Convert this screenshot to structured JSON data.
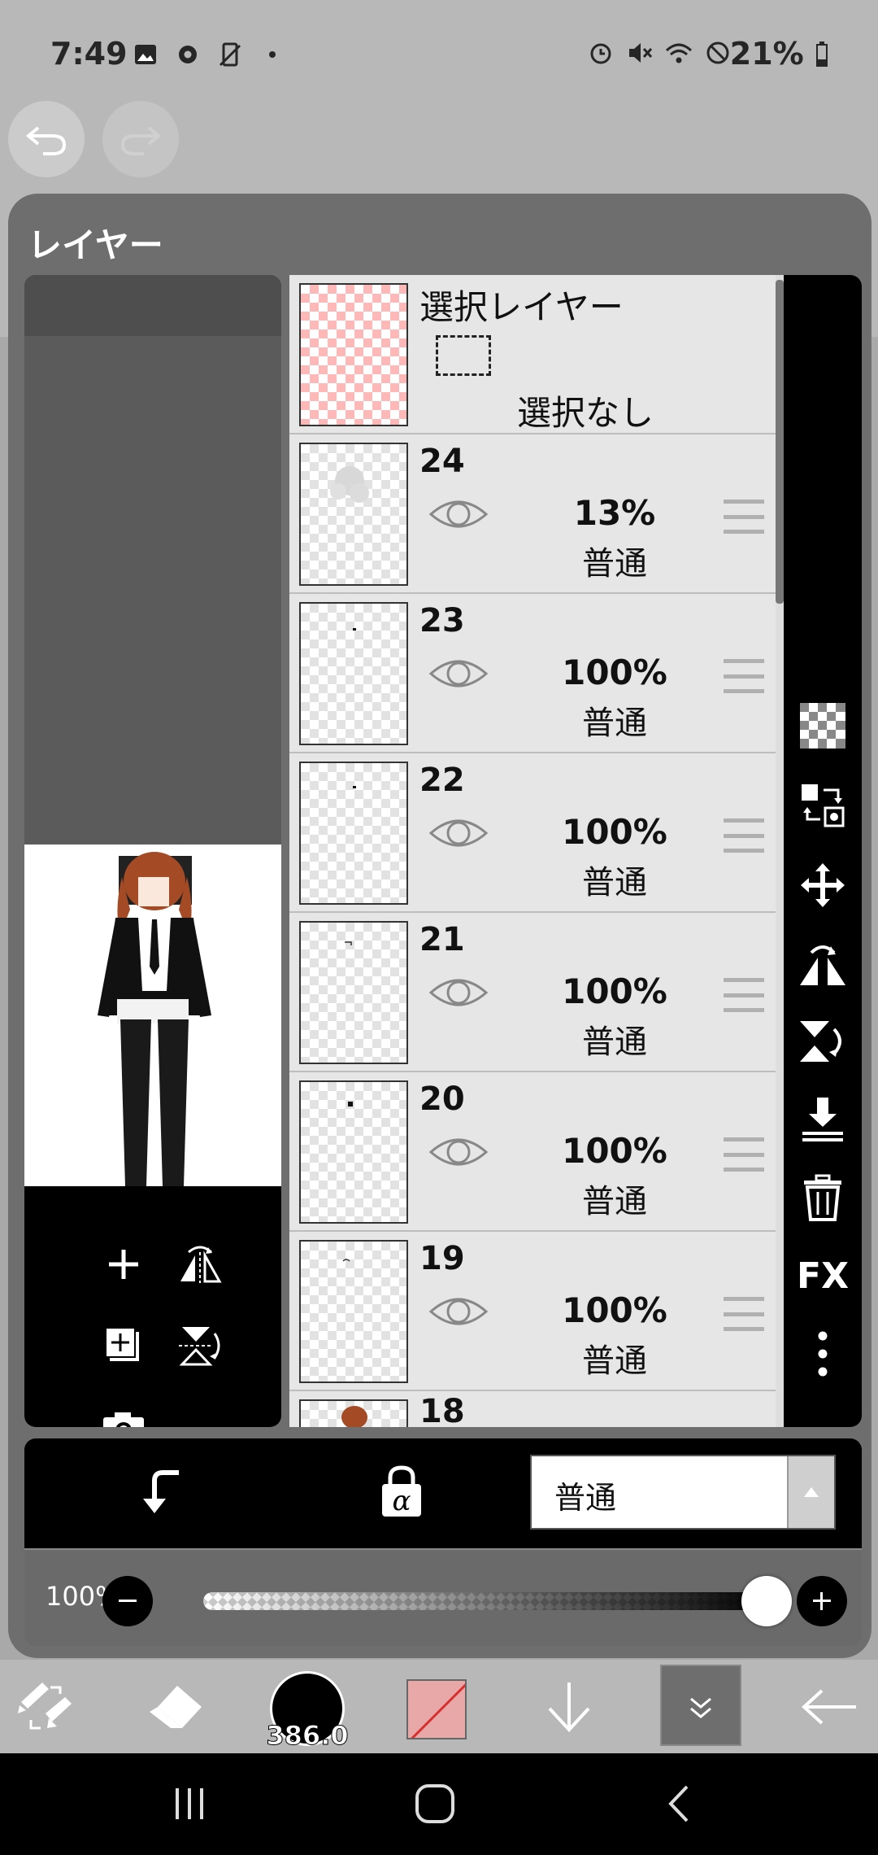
{
  "status_bar": {
    "time": "7:49",
    "battery": "21%"
  },
  "panel": {
    "title": "レイヤー"
  },
  "selection_layer": {
    "title": "選択レイヤー",
    "status": "選択なし"
  },
  "layers": [
    {
      "name": "24",
      "opacity": "13%",
      "blend": "普通"
    },
    {
      "name": "23",
      "opacity": "100%",
      "blend": "普通"
    },
    {
      "name": "22",
      "opacity": "100%",
      "blend": "普通"
    },
    {
      "name": "21",
      "opacity": "100%",
      "blend": "普通"
    },
    {
      "name": "20",
      "opacity": "100%",
      "blend": "普通"
    },
    {
      "name": "19",
      "opacity": "100%",
      "blend": "普通"
    },
    {
      "name": "18",
      "opacity": "",
      "blend": ""
    }
  ],
  "right_toolbar": {
    "fx_label": "FX"
  },
  "action_bar": {
    "blend_mode": "普通"
  },
  "opacity_slider": {
    "label": "100%",
    "value": 1.0
  },
  "tool_bar": {
    "brush_size": "386.0"
  },
  "colors": {
    "accent_color": "#e8a8a8",
    "panel_bg": "#6e6e6e",
    "toolbar_bg": "#000000"
  },
  "icons": [
    "undo-icon",
    "redo-icon",
    "add-layer-icon",
    "flip-horizontal-icon",
    "duplicate-layer-icon",
    "flip-vertical-icon",
    "camera-icon",
    "checker-icon",
    "layer-swap-icon",
    "move-icon",
    "mirror-h-icon",
    "mirror-v-icon",
    "merge-down-icon",
    "trash-icon",
    "fx-icon",
    "more-icon",
    "clip-icon",
    "alpha-lock-icon",
    "tool-switch-icon",
    "eraser-icon",
    "down-arrow-icon",
    "layers-toggle-icon",
    "back-arrow-icon"
  ]
}
